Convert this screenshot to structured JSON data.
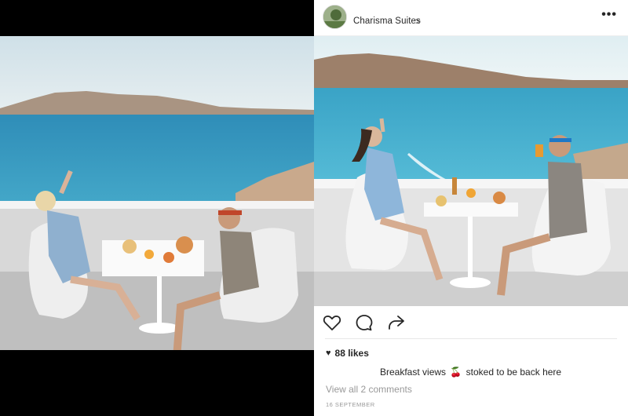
{
  "post": {
    "account_name": "Charisma Suites",
    "chevron": ">",
    "more": "•••",
    "likes": "88 likes",
    "likes_heart": "♥",
    "caption_before": "Breakfast views",
    "caption_emoji": "🍒",
    "caption_after": "stoked to be back here",
    "view_comments": "View all 2 comments",
    "date": "16 SEPTEMBER"
  },
  "icons": {
    "like": "heart-icon",
    "comment": "comment-bubble-icon",
    "share": "share-arrow-icon",
    "more": "more-options-icon"
  },
  "colors": {
    "text": "#262626",
    "muted": "#999999",
    "sea": "#3fa6c8",
    "sky": "#d9e8ee"
  }
}
